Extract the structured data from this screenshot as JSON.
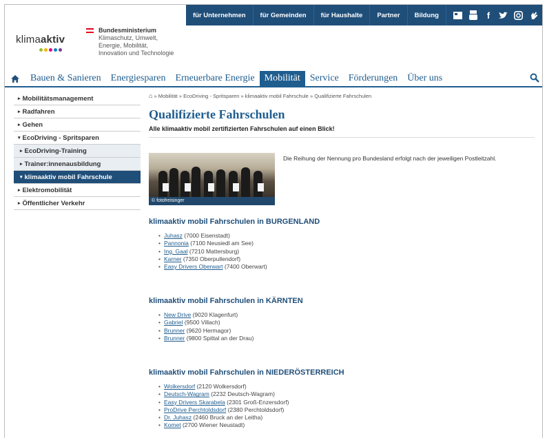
{
  "topbar": {
    "links": [
      "für Unternehmen",
      "für Gemeinden",
      "für Haushalte",
      "Partner",
      "Bildung"
    ],
    "icons": [
      "newsletter-icon",
      "youtube-icon",
      "facebook-icon",
      "twitter-icon",
      "instagram-icon",
      "gebaerdensprache-icon"
    ]
  },
  "logo": {
    "prefix": "klima",
    "bold": "aktiv",
    "dot_colors": [
      "#9bbf2c",
      "#f5b400",
      "#e5007d",
      "#0086c7",
      "#7a3c96"
    ]
  },
  "ministry": {
    "lines": [
      "Bundesministerium",
      "Klimaschutz, Umwelt,",
      "Energie, Mobilität,",
      "Innovation und Technologie"
    ]
  },
  "nav": {
    "items": [
      "Bauen & Sanieren",
      "Energiesparen",
      "Erneuerbare Energie",
      "Mobilität",
      "Service",
      "Förderungen",
      "Über uns"
    ],
    "active_index": 3
  },
  "sidebar": {
    "items": [
      {
        "label": "Mobilitätsmanagement",
        "kind": "top",
        "caret": "▸"
      },
      {
        "label": "Radfahren",
        "kind": "top",
        "caret": "▸"
      },
      {
        "label": "Gehen",
        "kind": "top",
        "caret": "▸"
      },
      {
        "label": "EcoDriving - Spritsparen",
        "kind": "top",
        "caret": "▾"
      },
      {
        "label": "EcoDriving-Training",
        "kind": "sub",
        "caret": "▸"
      },
      {
        "label": "Trainer:innenausbildung",
        "kind": "sub",
        "caret": "▸"
      },
      {
        "label": "klimaaktiv mobil Fahrschule",
        "kind": "current",
        "caret": "▾"
      },
      {
        "label": "Elektromobilität",
        "kind": "top",
        "caret": "▸"
      },
      {
        "label": "Öffentlicher Verkehr",
        "kind": "top",
        "caret": "▸"
      }
    ]
  },
  "breadcrumb": [
    "Mobilität",
    "EcoDriving - Spritsparen",
    "klimaaktiv mobil Fahrschule",
    "Qualifizierte Fahrschulen"
  ],
  "page": {
    "title": "Qualifizierte Fahrschulen",
    "lead": "Alle klimaaktiv mobil zertifizierten Fahrschulen auf einen Blick!",
    "photo_credit": "© fotofreisinger",
    "intro": "Die Reihung der Nennung pro Bundesland erfolgt nach der jeweiligen Postleitzahl."
  },
  "sections": [
    {
      "heading": "klimaaktiv mobil Fahrschulen in BURGENLAND",
      "schools": [
        {
          "name": "Juhasz",
          "info": "(7000 Eisenstadt)"
        },
        {
          "name": "Pannonia",
          "info": "(7100 Neusiedl am See)"
        },
        {
          "name": "Ing. Gaal",
          "info": "(7210 Mattersburg)"
        },
        {
          "name": "Karner",
          "info": "(7350 Oberpullendorf)"
        },
        {
          "name": "Easy Drivers Oberwart",
          "info": "(7400 Oberwart)"
        }
      ]
    },
    {
      "heading": "klimaaktiv mobil Fahrschulen in KÄRNTEN",
      "schools": [
        {
          "name": "New Drive",
          "info": "(9020 Klagenfurt)"
        },
        {
          "name": "Gabriel",
          "info": "(9500 Villach)"
        },
        {
          "name": "Brunner",
          "info": "(9620 Hermagor)"
        },
        {
          "name": "Brunner",
          "info": "(9800 Spittal an der Drau)"
        }
      ]
    },
    {
      "heading": "klimaaktiv mobil Fahrschulen in NIEDERÖSTERREICH",
      "schools": [
        {
          "name": "Wolkersdorf",
          "info": "(2120 Wolkersdorf)"
        },
        {
          "name": "Deutsch-Wagram",
          "info": "(2232 Deutsch-Wagram)"
        },
        {
          "name": "Easy Drivers Skarabela",
          "info": "(2301 Groß-Enzersdorf)"
        },
        {
          "name": "ProDrive Perchtoldsdorf",
          "info": "(2380 Perchtoldsdorf)"
        },
        {
          "name": "Dr. Juhasz",
          "info": "(2460 Bruck an der Leitha)"
        },
        {
          "name": "Komet",
          "info": "(2700 Wiener Neustadt)"
        }
      ]
    }
  ]
}
